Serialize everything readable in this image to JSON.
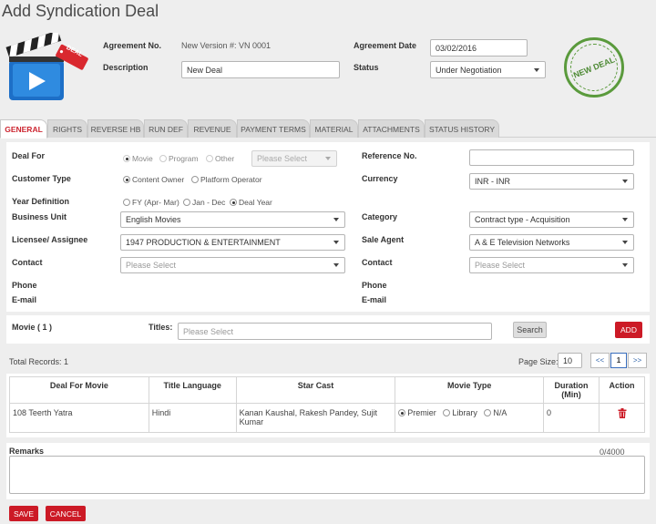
{
  "page": {
    "title": "Add Syndication Deal"
  },
  "header": {
    "agreement_no_label": "Agreement No.",
    "agreement_no_value": "New Version #: VN 0001",
    "agreement_date_label": "Agreement Date",
    "agreement_date_value": "03/02/2016",
    "description_label": "Description",
    "description_value": "New Deal",
    "status_label": "Status",
    "status_value": "Under Negotiation",
    "logo_badge": "DEAL",
    "stamp_text": "NEW DEAL"
  },
  "tabs": [
    {
      "label": "General",
      "active": true
    },
    {
      "label": "Rights"
    },
    {
      "label": "Reverse HB"
    },
    {
      "label": "Run Def"
    },
    {
      "label": "Revenue"
    },
    {
      "label": "Payment Terms"
    },
    {
      "label": "Material"
    },
    {
      "label": "Attachments"
    },
    {
      "label": "Status History"
    }
  ],
  "form": {
    "deal_for": {
      "label": "Deal For",
      "options": [
        "Movie",
        "Program",
        "Other"
      ],
      "selected": "Movie",
      "other_placeholder": "Please Select"
    },
    "reference_no": {
      "label": "Reference No.",
      "value": ""
    },
    "customer_type": {
      "label": "Customer Type",
      "options": [
        "Content Owner",
        "Platform Operator"
      ],
      "selected": "Content Owner"
    },
    "currency": {
      "label": "Currency",
      "value": "INR - INR"
    },
    "year_definition": {
      "label": "Year Definition",
      "options": [
        "FY (Apr- Mar)",
        "Jan - Dec",
        "Deal Year"
      ],
      "selected": "Deal Year"
    },
    "business_unit": {
      "label": "Business Unit",
      "value": "English Movies"
    },
    "category": {
      "label": "Category",
      "value": "Contract type - Acquisition"
    },
    "licensee": {
      "label": "Licensee/ Assignee",
      "value": "1947 PRODUCTION & ENTERTAINMENT"
    },
    "sale_agent": {
      "label": "Sale Agent",
      "value": "A & E Television Networks"
    },
    "contact_left": {
      "label": "Contact",
      "placeholder": "Please Select"
    },
    "contact_right": {
      "label": "Contact",
      "placeholder": "Please Select"
    },
    "phone_left": "Phone",
    "phone_right": "Phone",
    "email_left": "E-mail",
    "email_right": "E-mail"
  },
  "movie": {
    "label": "Movie ( 1 )",
    "titles_label": "Titles:",
    "titles_placeholder": "Please Select",
    "search_label": "Search",
    "add_label": "ADD"
  },
  "records": {
    "total_label": "Total Records:",
    "total_value": "1",
    "page_size_label": "Page Size:",
    "page_size_value": "10",
    "prev": "<<",
    "current_page": "1",
    "next": ">>"
  },
  "table": {
    "headers": [
      "Deal For Movie",
      "Title Language",
      "Star Cast",
      "Movie Type",
      "Duration (Min)",
      "Action"
    ],
    "rows": [
      {
        "movie": "108 Teerth Yatra",
        "language": "Hindi",
        "star_cast": "Kanan Kaushal, Rakesh Pandey, Sujit Kumar",
        "movie_type_options": [
          "Premier",
          "Library",
          "N/A"
        ],
        "movie_type_selected": "Premier",
        "duration": "0",
        "action_icon": "trash-icon"
      }
    ]
  },
  "remarks": {
    "label": "Remarks",
    "counter": "0/4000",
    "value": ""
  },
  "actions": {
    "save": "SAVE",
    "cancel": "CANCEL"
  },
  "colors": {
    "accent": "#cc1a26",
    "tab_active": "#cc2530",
    "stamp": "#5a9a3c"
  }
}
